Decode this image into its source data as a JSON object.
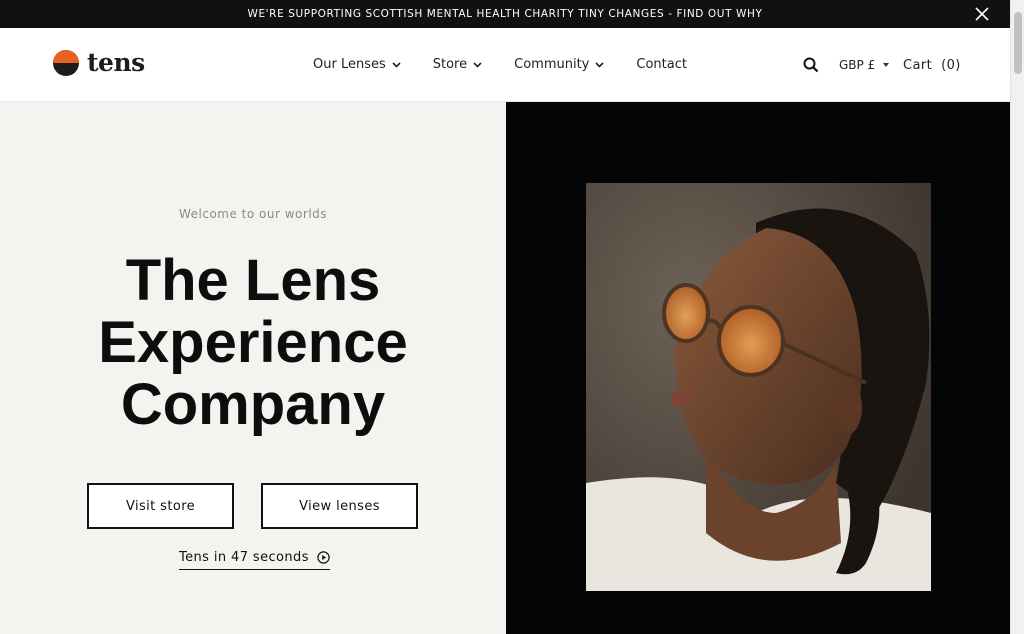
{
  "announcement": {
    "text": "WE'RE SUPPORTING SCOTTISH MENTAL HEALTH CHARITY TINY CHANGES - FIND OUT WHY"
  },
  "header": {
    "logo_text": "tens",
    "nav": [
      {
        "label": "Our Lenses",
        "has_dropdown": true
      },
      {
        "label": "Store",
        "has_dropdown": true
      },
      {
        "label": "Community",
        "has_dropdown": true
      },
      {
        "label": "Contact",
        "has_dropdown": false
      }
    ],
    "currency": "GBP £",
    "cart": "Cart  (0)"
  },
  "hero": {
    "kicker": "Welcome to our worlds",
    "headline": [
      "The Lens",
      "Experience",
      "Company"
    ],
    "buttons": {
      "visit_store": "Visit store",
      "view_lenses": "View lenses"
    },
    "video_link": "Tens in 47 seconds"
  },
  "colors": {
    "brand_orange": "#e8611e",
    "dark": "#111111",
    "hero_bg": "#f4f3f0"
  },
  "icons": [
    "close-icon",
    "chevron-down-icon",
    "search-icon",
    "play-circle-icon"
  ]
}
